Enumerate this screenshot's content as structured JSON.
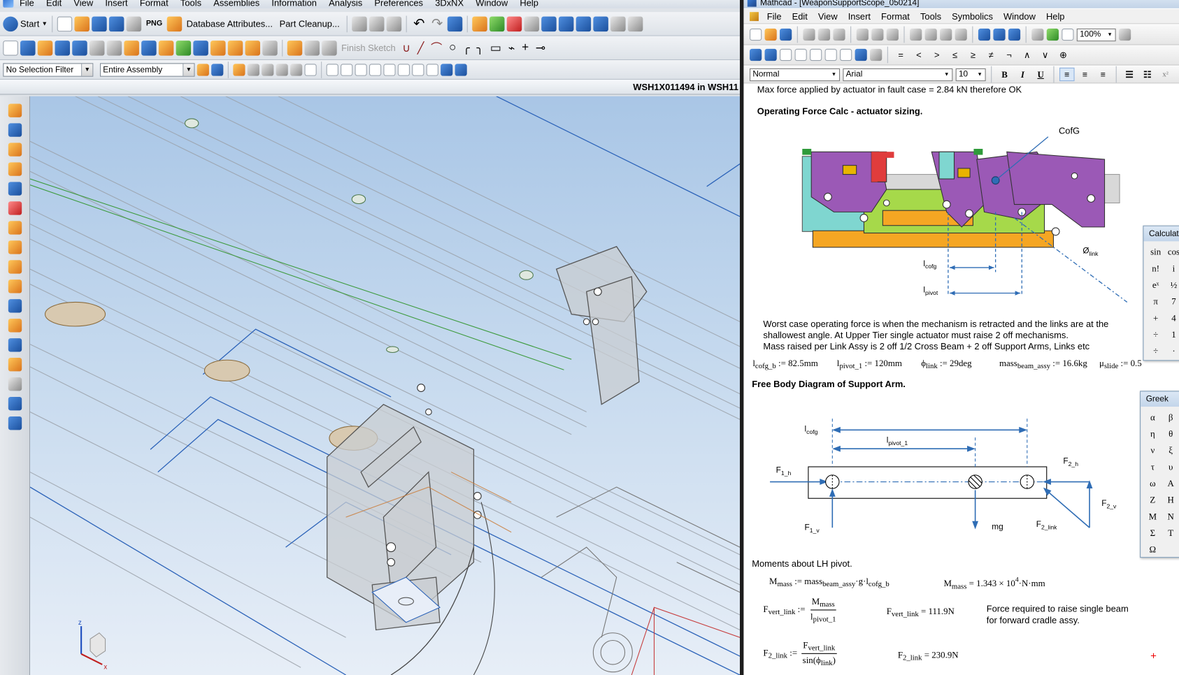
{
  "nx": {
    "menu": [
      "File",
      "Edit",
      "View",
      "Insert",
      "Format",
      "Tools",
      "Assemblies",
      "Information",
      "Analysis",
      "Preferences",
      "3DxNX",
      "Window",
      "Help"
    ],
    "toolbar1": {
      "start": "Start",
      "png_label": "PNG",
      "database_attributes": "Database Attributes...",
      "part_cleanup": "Part Cleanup..."
    },
    "toolbar2": {
      "finish_sketch": "Finish Sketch"
    },
    "toolbar3": {
      "selection_filter": "No Selection Filter",
      "scope": "Entire Assembly"
    },
    "window_title": "WSH1X011494 in WSH11",
    "triad_labels": {
      "x": "x",
      "z": "z"
    }
  },
  "mathcad": {
    "title": "Mathcad - [WeaponSupportScope_050214]",
    "menu": [
      "File",
      "Edit",
      "View",
      "Insert",
      "Format",
      "Tools",
      "Symbolics",
      "Window",
      "Help"
    ],
    "zoom": "100%",
    "style": "Normal",
    "font": "Arial",
    "font_size": "10",
    "format_buttons": {
      "bold": "B",
      "italic": "I",
      "underline": "U"
    },
    "math_ops": [
      "=",
      "<",
      ">",
      "≤",
      "≥",
      "≠",
      "¬",
      "∧",
      "∨",
      "⊕"
    ],
    "worksheet": {
      "line_top": "Max force applied by actuator in fault case = 2.84 kN therefore OK",
      "heading1": "Operating Force Calc - actuator sizing.",
      "cofg_label": "CofG",
      "phi_link_main": "Ø",
      "phi_link_sub": "link",
      "l_cofg_main": "l",
      "l_cofg_sub": "cofg",
      "l_pivot_main": "l",
      "l_pivot_sub": "pivot",
      "paragraph": [
        "Worst case operating force is when the mechanism is retracted and the links are at the",
        "shallowest angle.  At Upper Tier single actuator must raise 2 off mechanisms.",
        "Mass raised per Link Assy is 2 off 1/2 Cross Beam + 2 off Support Arms, Links etc"
      ],
      "defs": [
        {
          "name": "l",
          "sub": "cofg_b",
          "value": ":= 82.5mm"
        },
        {
          "name": "l",
          "sub": "pivot_1",
          "value": ":= 120mm"
        },
        {
          "name": "ϕ",
          "sub": "link",
          "value": ":= 29deg"
        },
        {
          "name": "mass",
          "sub": "beam_assy",
          "value": ":= 16.6kg"
        },
        {
          "name": "μ",
          "sub": "slide",
          "value": ":= 0.5"
        }
      ],
      "heading2": "Free Body Diagram of Support Arm.",
      "fbd": {
        "l_cofg_main": "l",
        "l_cofg_sub": "cofg",
        "l_pivot_main": "l",
        "l_pivot_sub": "pivot_1",
        "f1h_main": "F",
        "f1h_sub": "1_h",
        "f1v_main": "F",
        "f1v_sub": "1_v",
        "f2h_main": "F",
        "f2h_sub": "2_h",
        "f2v_main": "F",
        "f2v_sub": "2_v",
        "f2link_main": "F",
        "f2link_sub": "2_link",
        "mg": "mg"
      },
      "moments_heading": "Moments about LH pivot.",
      "m_mass_def": {
        "lhs": "M",
        "lhs_sub": "mass",
        "rhs1": "mass",
        "rhs1_sub": "beam_assy",
        "rhs2": "·g·l",
        "rhs2_sub": "cofg_b"
      },
      "m_mass_result": {
        "lhs": "M",
        "lhs_sub": "mass",
        "value": "= 1.343 × 10",
        "exp": "4",
        "unit": "·N·mm"
      },
      "f_vert_def": {
        "lhs": "F",
        "lhs_sub": "vert_link",
        "op": ":=",
        "num": "M",
        "num_sub": "mass",
        "den": "l",
        "den_sub": "pivot_1"
      },
      "f_vert_result": {
        "lhs": "F",
        "lhs_sub": "vert_link",
        "value": "= 111.9N"
      },
      "f_vert_note": [
        "Force required to raise single beam",
        "for forward cradle assy."
      ],
      "f2_def": {
        "lhs": "F",
        "lhs_sub": "2_link",
        "op": ":=",
        "num": "F",
        "num_sub": "vert_link",
        "den_a": "sin",
        "den_b": "ϕ",
        "den_sub": "link"
      },
      "f2_result": {
        "lhs": "F",
        "lhs_sub": "2_link",
        "value": "= 230.9N"
      },
      "red_cross": "+"
    },
    "calculator": {
      "title": "Calculat",
      "keys": [
        "sin",
        "cos",
        "n!",
        "i",
        "eˣ",
        "½",
        "π",
        "7",
        "+",
        "4",
        "÷",
        "1",
        "÷",
        "·"
      ]
    },
    "greek": {
      "title": "Greek",
      "letters": [
        "α",
        "β",
        "η",
        "θ",
        "ν",
        "ξ",
        "τ",
        "υ",
        "ω",
        "Α",
        "Ζ",
        "Η",
        "Μ",
        "Ν",
        "Σ",
        "Τ",
        "Ω",
        ""
      ]
    },
    "colors": {
      "link_purple": "#9b59b6",
      "block_orange": "#f5a623",
      "block_green": "#a6d94a",
      "block_cyan": "#7fd6d0",
      "dim_blue": "#2f6db5"
    }
  }
}
